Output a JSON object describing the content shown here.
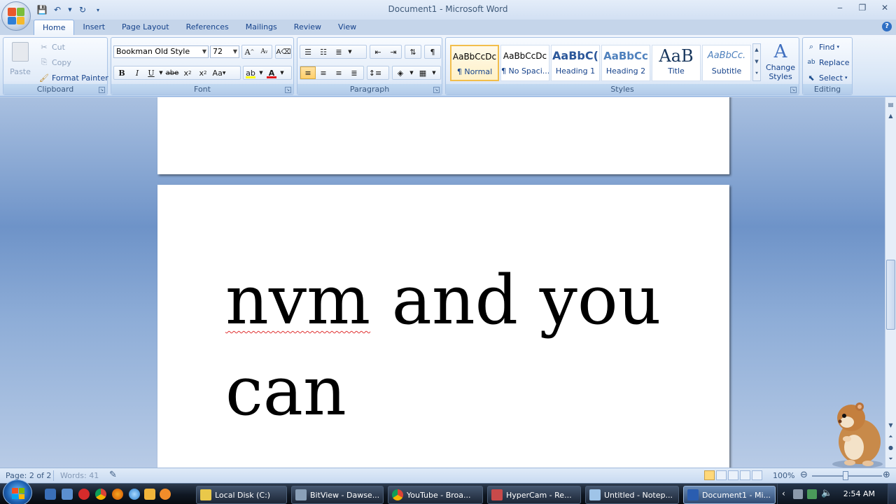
{
  "window": {
    "title": "Document1 - Microsoft Word",
    "minimize": "‒",
    "restore": "❐",
    "close": "✕"
  },
  "tabs": [
    "Home",
    "Insert",
    "Page Layout",
    "References",
    "Mailings",
    "Review",
    "View"
  ],
  "clipboard": {
    "paste": "Paste",
    "cut": "Cut",
    "copy": "Copy",
    "format_painter": "Format Painter",
    "label": "Clipboard"
  },
  "font": {
    "name": "Bookman Old Style",
    "size": "72",
    "label": "Font"
  },
  "paragraph": {
    "label": "Paragraph"
  },
  "styles": {
    "items": [
      {
        "sample": "AaBbCcDc",
        "name": "¶ Normal"
      },
      {
        "sample": "AaBbCcDc",
        "name": "¶ No Spaci..."
      },
      {
        "sample": "AaBbC(",
        "name": "Heading 1"
      },
      {
        "sample": "AaBbCc",
        "name": "Heading 2"
      },
      {
        "sample": "AaB",
        "name": "Title"
      },
      {
        "sample": "AaBbCc.",
        "name": "Subtitle"
      }
    ],
    "change_styles": "Change Styles",
    "label": "Styles"
  },
  "editing": {
    "find": "Find",
    "replace": "Replace",
    "select": "Select",
    "label": "Editing"
  },
  "document": {
    "misspelled_word": "nvm",
    "line1_rest": " and you",
    "line2": "can"
  },
  "statusbar": {
    "page": "Page: 2 of 2",
    "words": "Words: 41",
    "zoom": "100%"
  },
  "taskbar": {
    "items": [
      {
        "label": "Local Disk (C:)",
        "color": "#e9c84a"
      },
      {
        "label": "BitView - Dawse...",
        "color": "#8aa0b8"
      },
      {
        "label": "YouTube - Broa...",
        "color": "#4aa04a"
      },
      {
        "label": "HyperCam - Re...",
        "color": "#c84a4a"
      },
      {
        "label": "Untitled - Notep...",
        "color": "#9fc4e8"
      },
      {
        "label": "Document1 - Mi...",
        "color": "#2a5db0"
      }
    ],
    "clock": "2:54 AM"
  },
  "colors": {
    "ribbon_text": "#15428b",
    "highlight": "#ffcf6a",
    "font_color_red": "#e0151a",
    "highlighter_yellow": "#ffff00"
  }
}
